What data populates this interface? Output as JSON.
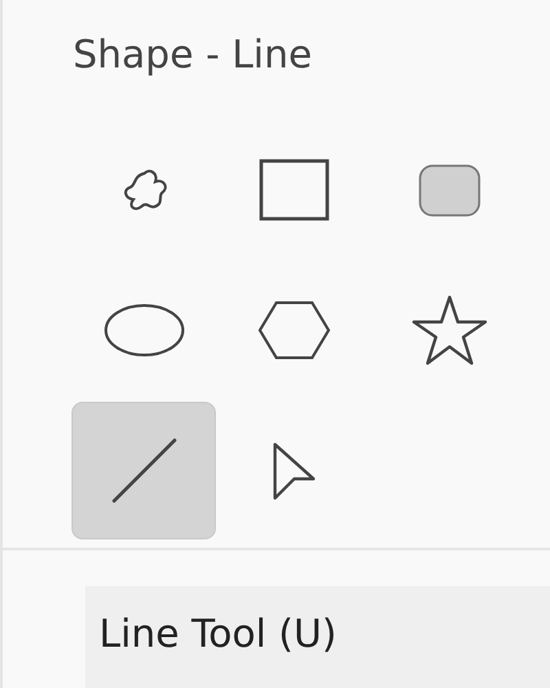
{
  "panel": {
    "title": "Shape - Line"
  },
  "tools": [
    {
      "kind": "freeform",
      "selected": false
    },
    {
      "kind": "rectangle",
      "selected": false
    },
    {
      "kind": "rounded-rectangle",
      "selected": false
    },
    {
      "kind": "ellipse",
      "selected": false
    },
    {
      "kind": "hexagon",
      "selected": false
    },
    {
      "kind": "star",
      "selected": false
    },
    {
      "kind": "line",
      "selected": true
    },
    {
      "kind": "pointer",
      "selected": false
    }
  ],
  "tooltip": {
    "text": "Line Tool (U)"
  }
}
